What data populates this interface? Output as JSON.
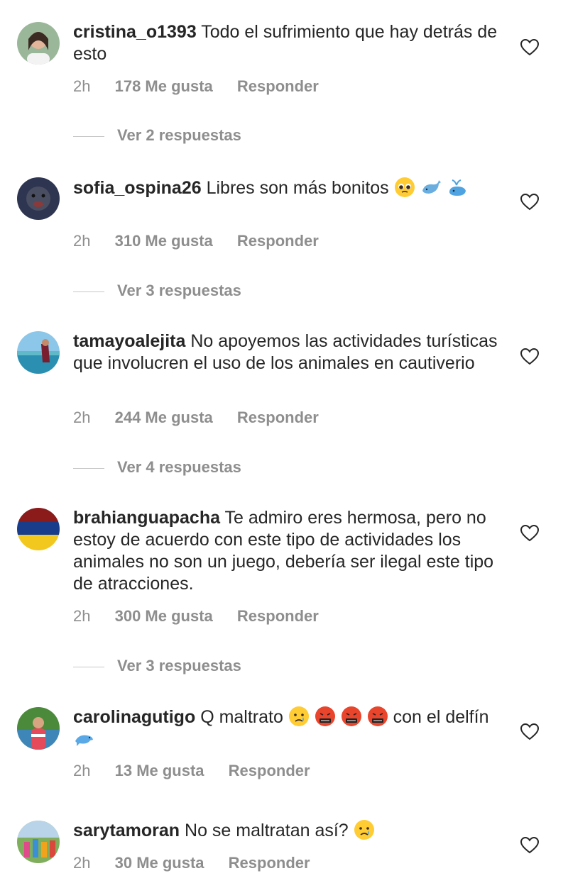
{
  "comments": [
    {
      "user": "cristina_o1393",
      "text": "Todo el sufrimiento que hay detrás de esto",
      "time": "2h",
      "likes": "178 Me gusta",
      "reply": "Responder",
      "replies": "Ver 2 respuestas"
    },
    {
      "user": "sofia_ospina26",
      "text": "Libres son más bonitos",
      "time": "2h",
      "likes": "310 Me gusta",
      "reply": "Responder",
      "replies": "Ver 3 respuestas"
    },
    {
      "user": "tamayoalejita",
      "text": "No apoyemos las actividades turísticas que involucren el uso de los animales en cautiverio",
      "time": "2h",
      "likes": "244 Me gusta",
      "reply": "Responder",
      "replies": "Ver 4 respuestas"
    },
    {
      "user": "brahianguapacha",
      "text": "Te admiro eres hermosa, pero no estoy de acuerdo con este tipo de actividades los animales no son un juego, debería ser ilegal este tipo de atracciones.",
      "time": "2h",
      "likes": "300 Me gusta",
      "reply": "Responder",
      "replies": "Ver 3 respuestas"
    },
    {
      "user": "carolinagutigo",
      "text_a": "Q maltrato",
      "text_b": "con el delfín",
      "time": "2h",
      "likes": "13 Me gusta",
      "reply": "Responder"
    },
    {
      "user": "sarytamoran",
      "text": "No se maltratan así?",
      "time": "2h",
      "likes": "30 Me gusta",
      "reply": "Responder"
    }
  ],
  "icons": {
    "like": "heart-outline-icon"
  },
  "colors": {
    "text": "#262626",
    "muted": "#8e8e8e",
    "divider": "#c7c7c7"
  }
}
